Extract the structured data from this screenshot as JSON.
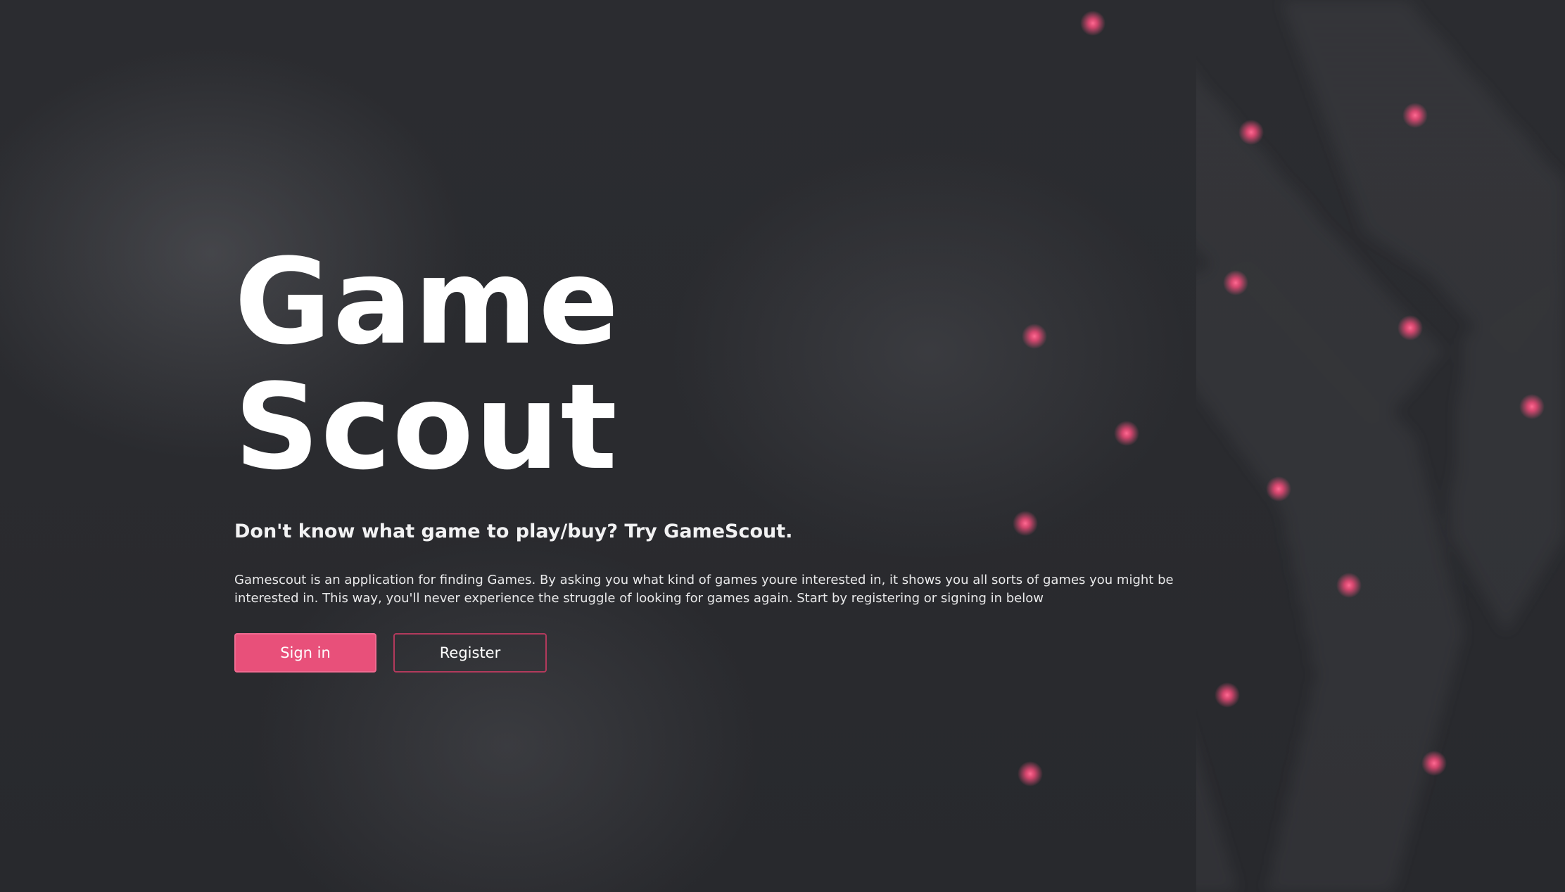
{
  "hero": {
    "title_line1": "Game",
    "title_line2": "Scout",
    "tagline": "Don't know what game to play/buy? Try GameScout.",
    "description": "Gamescout is an application for finding Games. By asking you what kind of games youre interested in, it shows you all sorts of games you might be interested in. This way, you'll never experience the struggle of looking for games again. Start by registering or signing in below"
  },
  "actions": {
    "sign_in_label": "Sign in",
    "register_label": "Register"
  },
  "colors": {
    "background": "#2a2b2f",
    "accent": "#e8507a",
    "glow_dot": "#ff4f7e",
    "text": "#ffffff"
  }
}
